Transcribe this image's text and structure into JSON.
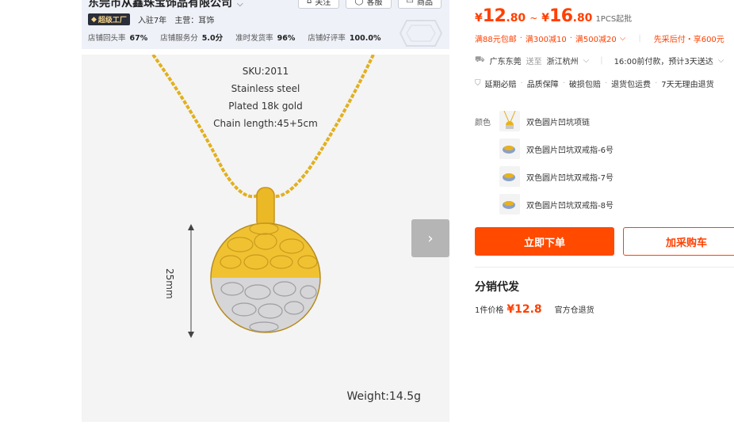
{
  "store": {
    "name": "东莞市从鑫珠宝饰品有限公司",
    "follow_label": "关注",
    "service_label": "客服",
    "shop_label": "商品",
    "badge_label": "超级工厂",
    "years": "入驻7年",
    "main_business": "主营：耳饰",
    "stats": [
      {
        "label": "店铺回头率",
        "value": "67%"
      },
      {
        "label": "店铺服务分",
        "value": "5.0分"
      },
      {
        "label": "准时发货率",
        "value": "96%"
      },
      {
        "label": "店铺好评率",
        "value": "100.0%"
      }
    ]
  },
  "product_image": {
    "sku": "SKU:2011",
    "material": "Stainless steel",
    "plating": "Plated 18k gold",
    "chain_length": "Chain length:45+5cm",
    "diameter": "25mm",
    "weight": "Weight:14.5g"
  },
  "price": {
    "currency": "¥",
    "low_int": "12",
    "low_dec": ".80",
    "tilde": "~",
    "high_int": "16",
    "high_dec": ".80",
    "moq": "1PCS起批"
  },
  "promos": {
    "free_ship": "满88元包邮",
    "discount_a": "满300减10",
    "discount_b": "满500减20",
    "pay_later": "先采后付・享600元"
  },
  "shipping": {
    "from": "广东东莞",
    "to_label": "送至",
    "to": "浙江杭州",
    "delivery": "16:00前付款，预计3天送达"
  },
  "services": [
    "延期必赔",
    "品质保障",
    "破损包赔",
    "退货包运费",
    "7天无理由退货"
  ],
  "color_section": {
    "label": "颜色",
    "options": [
      "双色圆片凹坑项链",
      "双色圆片凹坑双戒指-6号",
      "双色圆片凹坑双戒指-7号",
      "双色圆片凹坑双戒指-8号"
    ]
  },
  "actions": {
    "buy_now": "立即下单",
    "add_cart": "加采购车"
  },
  "distribution": {
    "title": "分销代发",
    "price_label": "1件价格",
    "price": "¥12.8",
    "note": "官方仓退货"
  },
  "colors": {
    "accent": "#ff4000",
    "button": "#ff4a00",
    "gold": "#e8b21c",
    "silver": "#c8c8c8"
  }
}
